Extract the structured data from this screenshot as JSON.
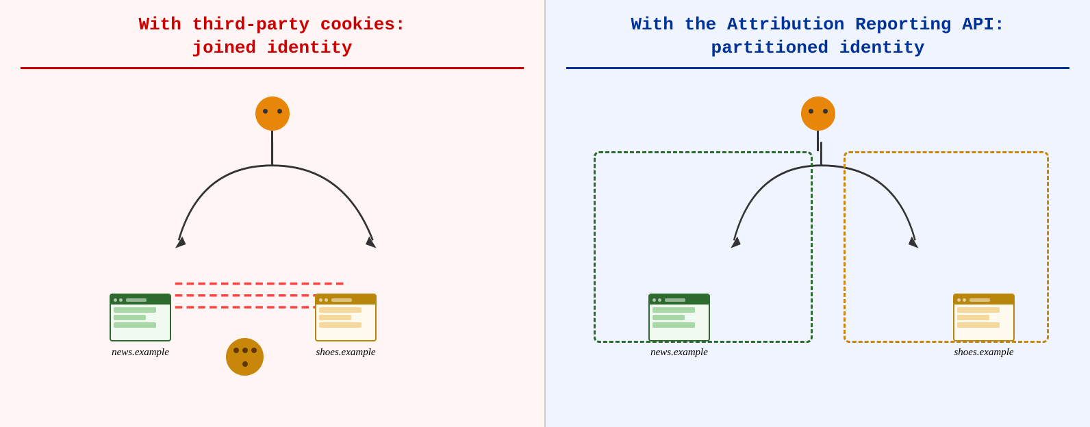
{
  "left_panel": {
    "title_line1": "With third-party cookies:",
    "title_line2": "joined identity",
    "news_label": "news.example",
    "shoes_label": "shoes.example",
    "bg_color": "#fff5f5",
    "title_color": "#cc0000",
    "divider_color": "#cc0000"
  },
  "right_panel": {
    "title_line1": "With the Attribution Reporting API:",
    "title_line2": "partitioned identity",
    "news_label": "news.example",
    "shoes_label": "shoes.example",
    "bg_color": "#f0f4ff",
    "title_color": "#003399",
    "divider_color": "#003399"
  }
}
